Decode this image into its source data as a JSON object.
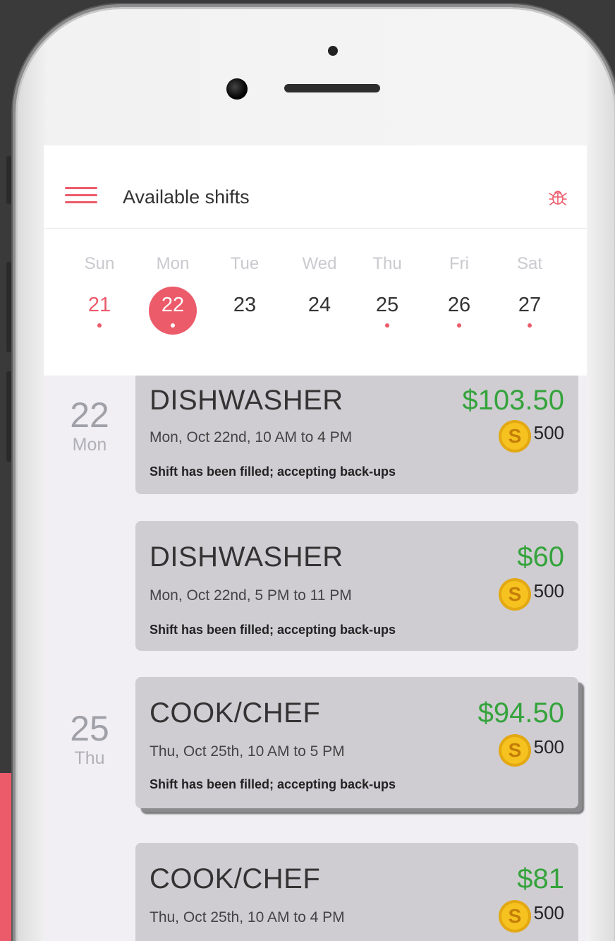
{
  "app": {
    "title": "Available shifts"
  },
  "colors": {
    "accent": "#ec5b6a",
    "pay": "#35a33c",
    "card": "#cfcdd2"
  },
  "icons": {
    "menu": "hamburger-icon",
    "bug": "bug-icon",
    "coin": "coin-icon"
  },
  "week": {
    "selected_index": 1,
    "days": [
      {
        "name": "Sun",
        "num": "21",
        "has_shifts": true,
        "state": "past"
      },
      {
        "name": "Mon",
        "num": "22",
        "has_shifts": true,
        "state": "selected"
      },
      {
        "name": "Tue",
        "num": "23",
        "has_shifts": false,
        "state": "normal"
      },
      {
        "name": "Wed",
        "num": "24",
        "has_shifts": false,
        "state": "normal"
      },
      {
        "name": "Thu",
        "num": "25",
        "has_shifts": true,
        "state": "normal"
      },
      {
        "name": "Fri",
        "num": "26",
        "has_shifts": true,
        "state": "normal"
      },
      {
        "name": "Sat",
        "num": "27",
        "has_shifts": true,
        "state": "normal"
      }
    ]
  },
  "groups": [
    {
      "num": "22",
      "dow": "Mon"
    },
    {
      "num": "25",
      "dow": "Thu"
    }
  ],
  "shifts": [
    {
      "role": "DISHWASHER",
      "pay": "$103.50",
      "time": "Mon, Oct 22nd, 10 AM to 4 PM",
      "points": "500",
      "status": "Shift has been filled; accepting back-ups"
    },
    {
      "role": "DISHWASHER",
      "pay": "$60",
      "time": "Mon, Oct 22nd, 5 PM to 11 PM",
      "points": "500",
      "status": "Shift has been filled; accepting back-ups"
    },
    {
      "role": "COOK/CHEF",
      "pay": "$94.50",
      "time": "Thu, Oct 25th, 10 AM to 5 PM",
      "points": "500",
      "status": "Shift has been filled; accepting back-ups"
    },
    {
      "role": "COOK/CHEF",
      "pay": "$81",
      "time": "Thu, Oct 25th, 10 AM to 4 PM",
      "points": "500",
      "status": ""
    }
  ]
}
